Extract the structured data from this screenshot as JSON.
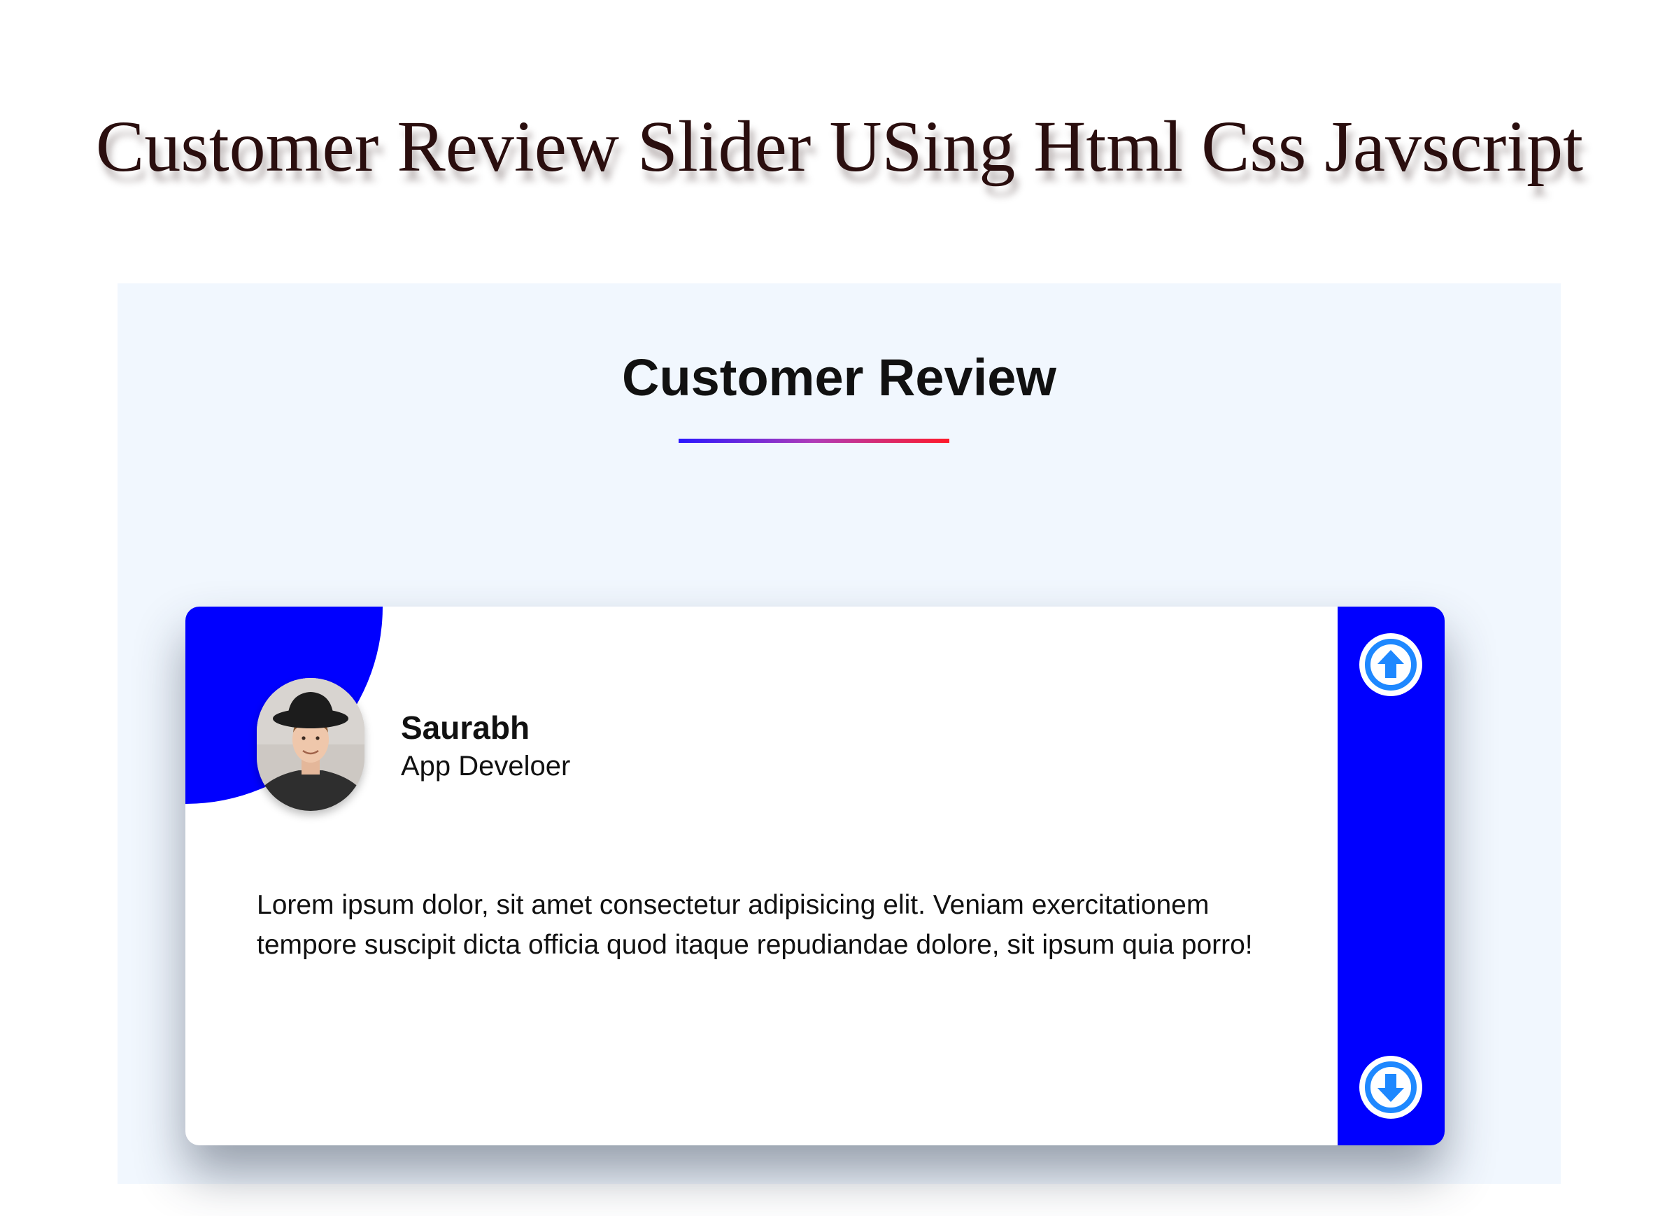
{
  "banner": {
    "title": "Customer Review Slider  USing Html Css Javscript"
  },
  "section": {
    "heading": "Customer Review"
  },
  "review": {
    "name": "Saurabh",
    "role": "App Develoer",
    "text": "Lorem ipsum dolor, sit amet consectetur adipisicing elit. Veniam exercitationem tempore suscipit dicta officia quod itaque repudiandae dolore, sit ipsum quia porro!"
  },
  "controls": {
    "up_icon": "arrow-up-circle-icon",
    "down_icon": "arrow-down-circle-icon"
  },
  "colors": {
    "accent": "#0000ff",
    "section_bg": "#f1f7fe",
    "icon_blue": "#1e88ff",
    "underline_start": "#2a17ff",
    "underline_end": "#ff1a2a"
  }
}
